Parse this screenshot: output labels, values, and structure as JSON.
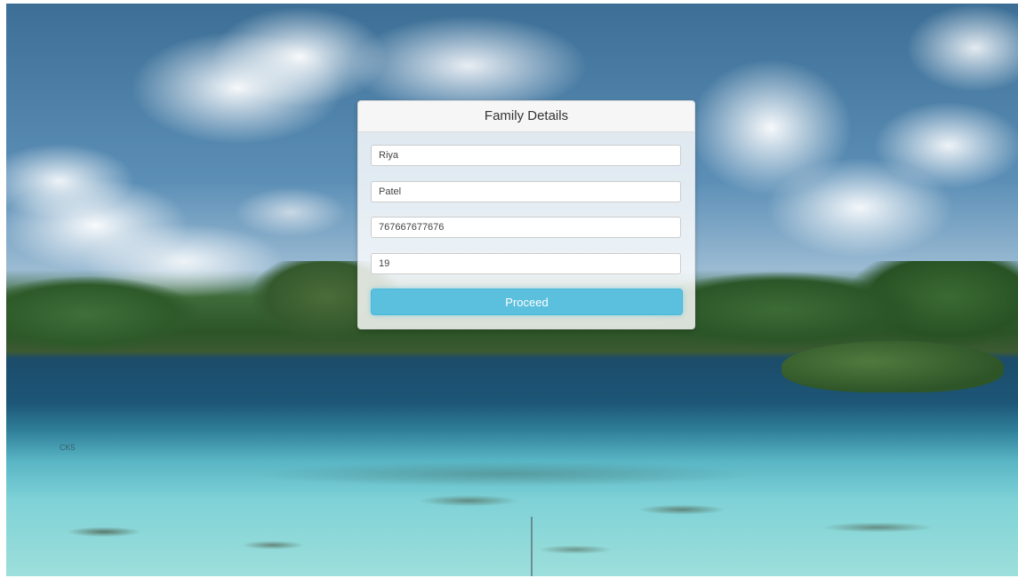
{
  "background": {
    "image": "tropical-lagoon-landscape",
    "corner_mark": "CK5"
  },
  "form": {
    "title": "Family Details",
    "fields": [
      {
        "name": "first_name",
        "value": "Riya"
      },
      {
        "name": "last_name",
        "value": "Patel"
      },
      {
        "name": "phone",
        "value": "767667677676"
      },
      {
        "name": "age",
        "value": "19"
      }
    ],
    "submit_label": "Proceed",
    "accent_color": "#5bc0de"
  }
}
